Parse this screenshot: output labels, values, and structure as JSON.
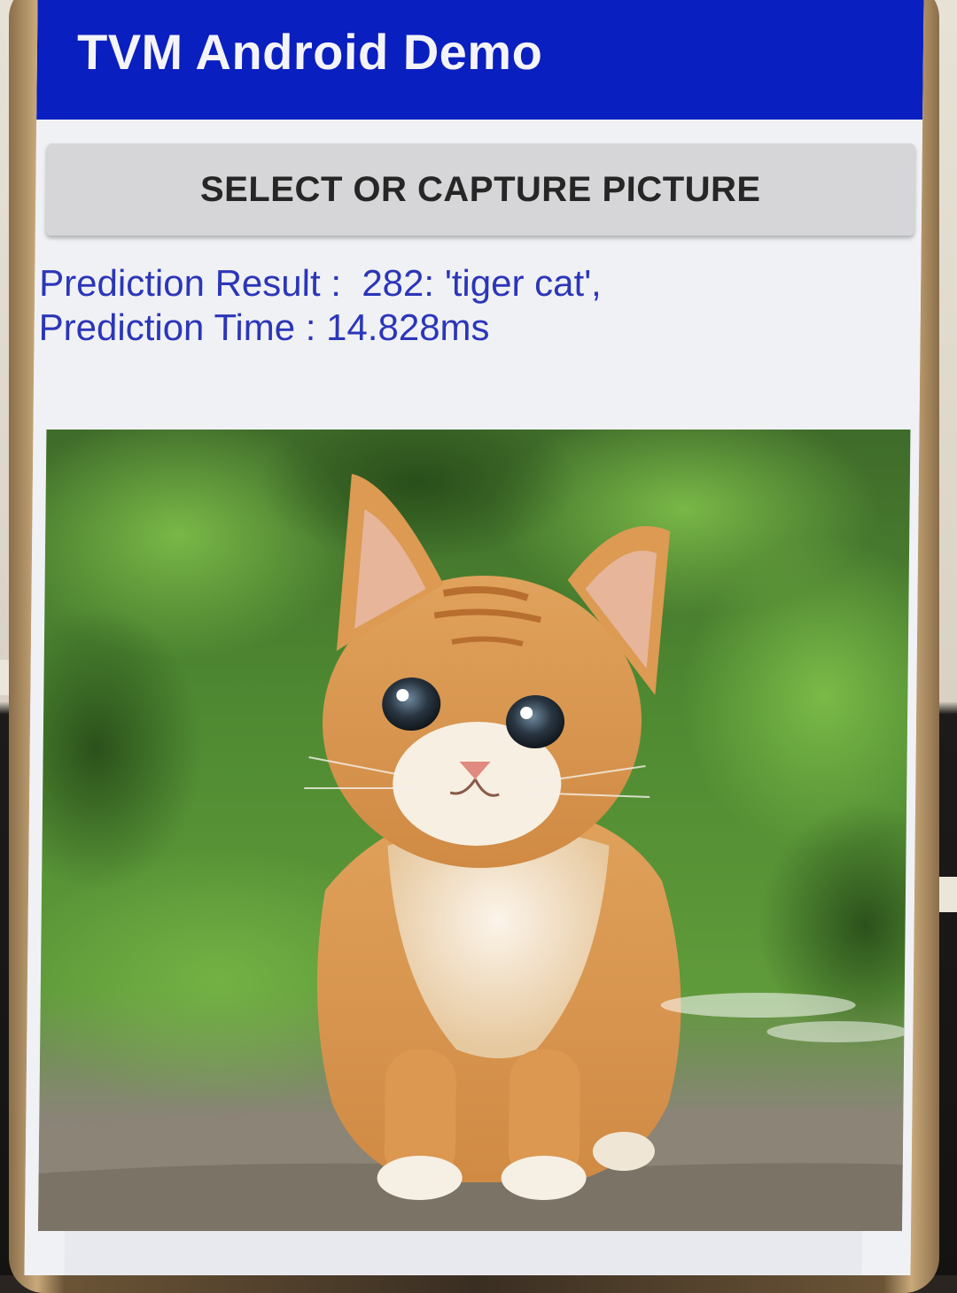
{
  "app": {
    "title": "TVM Android Demo"
  },
  "actions": {
    "select_capture_label": "SELECT OR CAPTURE PICTURE"
  },
  "result": {
    "prediction_line": "Prediction Result :  282: 'tiger cat',",
    "time_line": "Prediction Time : 14.828ms"
  },
  "colors": {
    "app_bar": "#0a1fbf",
    "result_text": "#2b36b8",
    "button_bg": "#d6d6d8"
  },
  "image": {
    "subject": "orange tabby kitten"
  }
}
